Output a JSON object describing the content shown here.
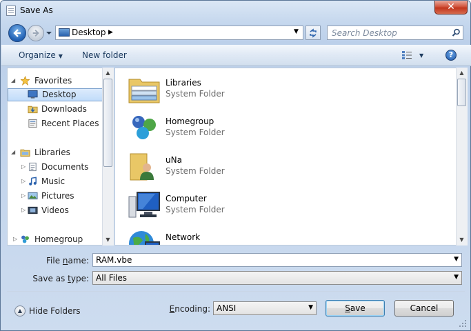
{
  "window": {
    "title": "Save As",
    "close_label": "✕"
  },
  "nav": {
    "address_location": "Desktop",
    "search_placeholder": "Search Desktop"
  },
  "toolbar": {
    "organize_label": "Organize",
    "new_folder_label": "New folder",
    "help_label": "?"
  },
  "navigation_pane": {
    "favorites": {
      "label": "Favorites",
      "items": [
        "Desktop",
        "Downloads",
        "Recent Places"
      ]
    },
    "libraries": {
      "label": "Libraries",
      "items": [
        "Documents",
        "Music",
        "Pictures",
        "Videos"
      ]
    },
    "homegroup": {
      "label": "Homegroup"
    },
    "selected": "Desktop"
  },
  "files": [
    {
      "name": "Libraries",
      "type": "System Folder",
      "icon": "libraries-icon"
    },
    {
      "name": "Homegroup",
      "type": "System Folder",
      "icon": "homegroup-icon"
    },
    {
      "name": "uNa",
      "type": "System Folder",
      "icon": "user-folder-icon"
    },
    {
      "name": "Computer",
      "type": "System Folder",
      "icon": "computer-icon"
    },
    {
      "name": "Network",
      "type": "",
      "icon": "network-icon"
    }
  ],
  "form": {
    "file_name_label_pre": "File ",
    "file_name_label_key": "n",
    "file_name_label_post": "ame:",
    "file_name_value": "RAM.vbe",
    "save_type_label_pre": "Save as ",
    "save_type_label_key": "t",
    "save_type_label_post": "ype:",
    "save_type_value": "All Files",
    "encoding_label_pre": "",
    "encoding_label_key": "E",
    "encoding_label_post": "ncoding:",
    "encoding_value": "ANSI",
    "hide_folders_label": "Hide Folders",
    "save_key": "S",
    "save_rest": "ave",
    "cancel_label": "Cancel"
  },
  "colors": {
    "selection": "#c1dcfa",
    "frame": "#bcd0ea",
    "accent": "#1f5fb3"
  }
}
